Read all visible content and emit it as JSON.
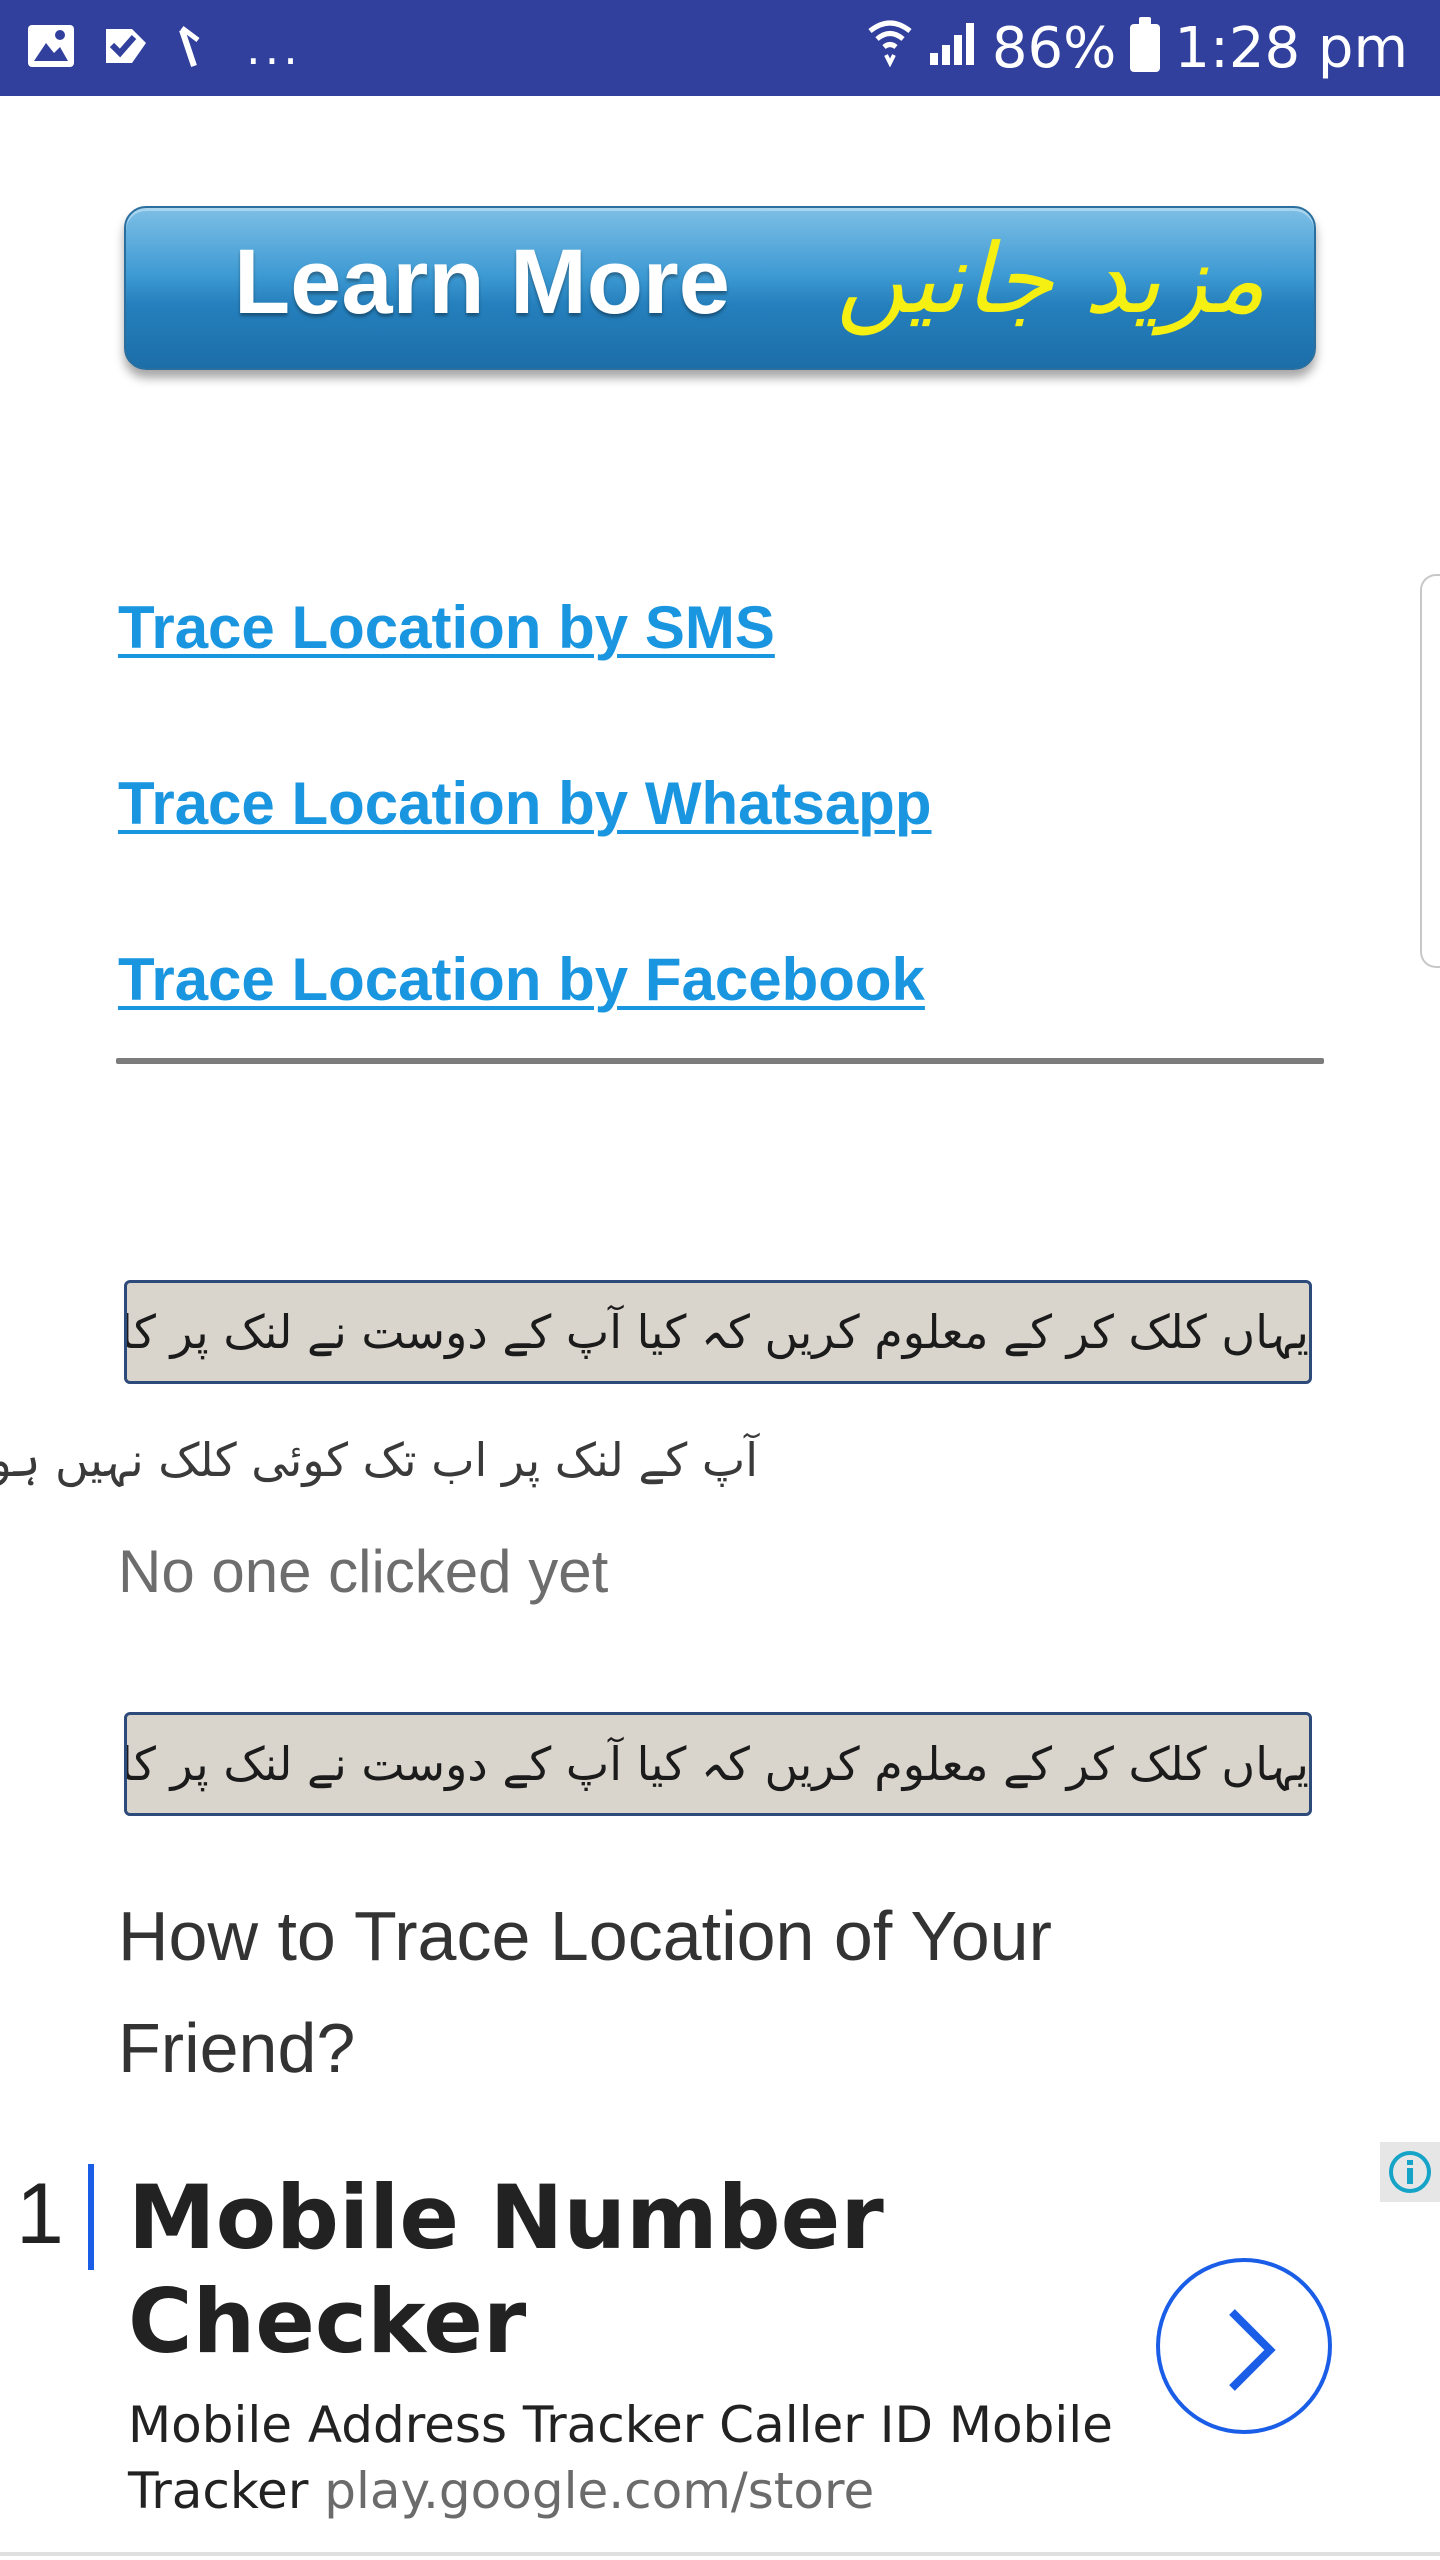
{
  "status_bar": {
    "icons": [
      "image-icon",
      "task-check-icon",
      "missed-call-icon",
      "wifi-icon",
      "signal-icon",
      "battery-icon"
    ],
    "more": "...",
    "battery": "86%",
    "time": "1:28 pm"
  },
  "banner": {
    "label_en": "Learn More",
    "label_ur": "مزید جانیں"
  },
  "links": [
    "Trace Location by SMS",
    "Trace Location by Whatsapp",
    "Trace Location by Facebook"
  ],
  "check_button": {
    "label": "یہاں کلک کر کے معلوم کریں کہ کیا آپ کے دوست نے لنک پر کلک کی ہے؟"
  },
  "status": {
    "urdu": "آپ کے لنک پر اب تک کوئی کلک نہیں ہوئی",
    "english": "No one clicked yet"
  },
  "check_button_2": {
    "label": "یہاں کلک کر کے معلوم کریں کہ کیا آپ کے دوست نے لنک پر کلک کی ہے؟"
  },
  "heading": "How to Trace Location of Your Friend?",
  "ad": {
    "number": "1",
    "title": "Mobile Number Checker",
    "description": "Mobile Address Tracker Caller ID Mobile Tracker",
    "url": "play.google.com/store",
    "accent_color": "#1a5ee8"
  }
}
